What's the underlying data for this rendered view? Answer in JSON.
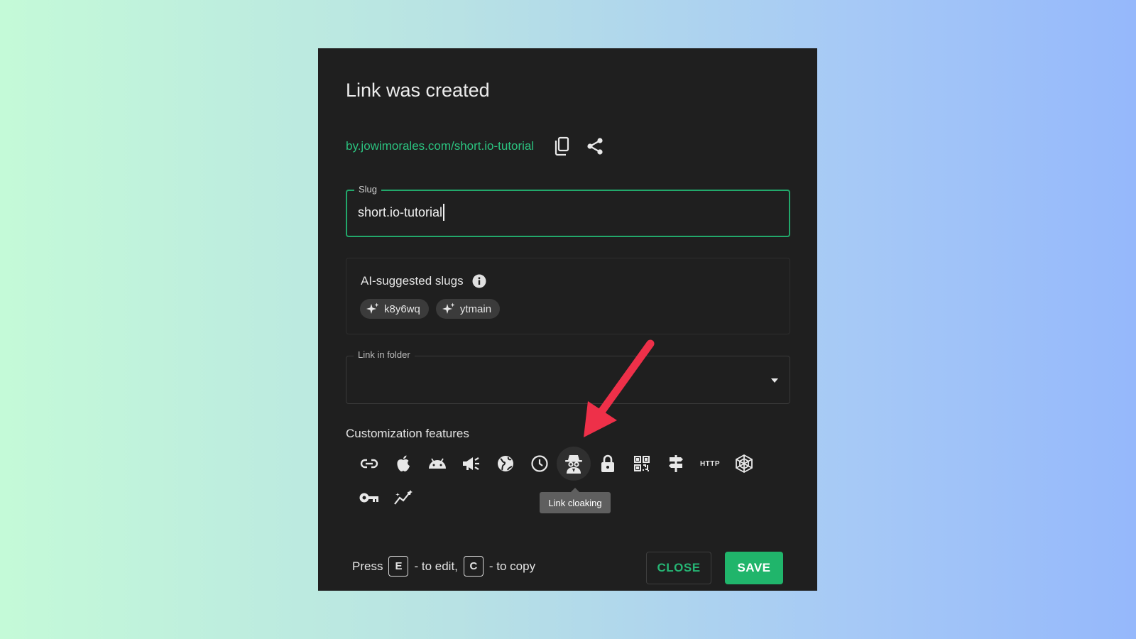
{
  "dialog": {
    "title": "Link was created",
    "short_url": "by.jowimorales.com/short.io-tutorial",
    "copy_icon": "copy-icon",
    "share_icon": "share-icon"
  },
  "slug": {
    "label": "Slug",
    "value": "short.io-tutorial"
  },
  "ai_suggestions": {
    "title": "AI-suggested slugs",
    "info_icon": "info-icon",
    "chips": [
      {
        "label": "k8y6wq",
        "icon": "sparkle-icon"
      },
      {
        "label": "ytmain",
        "icon": "sparkle-icon"
      }
    ]
  },
  "folder": {
    "label": "Link in folder",
    "value": ""
  },
  "customization": {
    "title": "Customization features",
    "features": [
      {
        "icon": "link-icon"
      },
      {
        "icon": "apple-icon"
      },
      {
        "icon": "android-icon"
      },
      {
        "icon": "megaphone-icon"
      },
      {
        "icon": "globe-icon"
      },
      {
        "icon": "clock-icon"
      },
      {
        "icon": "spy-icon",
        "active": true
      },
      {
        "icon": "lock-icon"
      },
      {
        "icon": "qr-code-icon"
      },
      {
        "icon": "signpost-icon"
      },
      {
        "icon": "http-icon",
        "text": "HTTP"
      },
      {
        "icon": "spider-web-icon"
      },
      {
        "icon": "key-icon"
      },
      {
        "icon": "magic-wand-icon"
      }
    ],
    "tooltip": "Link cloaking"
  },
  "footer": {
    "press": "Press",
    "edit_key": "E",
    "edit_text": "- to edit,",
    "copy_key": "C",
    "copy_text": "- to copy",
    "close_label": "CLOSE",
    "save_label": "SAVE"
  },
  "colors": {
    "accent": "#20b56b",
    "link": "#2bc27f",
    "dialog_bg": "#1f1f1f",
    "annotation_arrow": "#ee3049"
  }
}
